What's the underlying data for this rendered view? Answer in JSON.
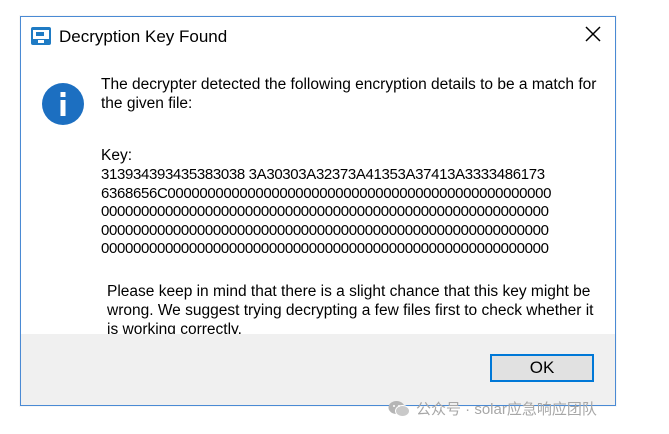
{
  "dialog": {
    "title": "Decryption Key Found",
    "title_icon": "app-window-icon",
    "close_icon": "close-icon",
    "info_icon": "info-icon",
    "message": "The decrypter detected the following encryption details to be a match for the given file:",
    "key_label": "Key:",
    "key_lines": [
      "313934393435383038 3A30303A32373A41353A37413A3333486173",
      "6368656C000000000000000000000000000000000000000000000000",
      "00000000000000000000000000000000000000000000000000000000",
      "00000000000000000000000000000000000000000000000000000000",
      "00000000000000000000000000000000000000000000000000000000"
    ],
    "warning": "Please keep in mind that there is a slight chance that this key might be wrong. We suggest trying decrypting a few files first to check whether it is working correctly.",
    "ok_label": "OK"
  },
  "watermark": {
    "text": "公众号 · solar应急响应团队",
    "icon": "wechat-icon"
  },
  "colors": {
    "accent": "#0078d7",
    "border": "#4a8ad4",
    "footer_bg": "#f0f0f0",
    "info_blue": "#1c6fc1"
  }
}
